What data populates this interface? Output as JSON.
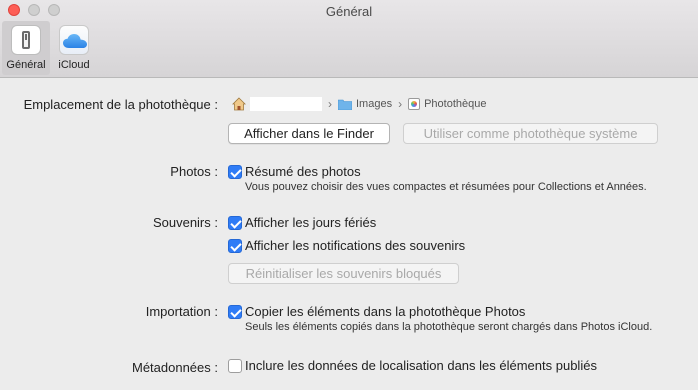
{
  "window": {
    "title": "Général"
  },
  "toolbar": {
    "items": [
      {
        "label": "Général",
        "icon": "general-switch-icon",
        "selected": true
      },
      {
        "label": "iCloud",
        "icon": "icloud-icon",
        "selected": false
      }
    ]
  },
  "library": {
    "label": "Emplacement de la photothèque :",
    "path": [
      {
        "icon": "home-icon",
        "text": ""
      },
      {
        "icon": "folder-icon",
        "text": "Images"
      },
      {
        "icon": "photo-library-icon",
        "text": "Photothèque"
      }
    ],
    "show_in_finder": "Afficher dans le Finder",
    "use_as_system_library": "Utiliser comme photothèque système"
  },
  "photos": {
    "label": "Photos :",
    "summarize": {
      "label": "Résumé des photos",
      "checked": true
    },
    "help": "Vous pouvez choisir des vues compactes et résumées pour Collections et Années."
  },
  "memories": {
    "label": "Souvenirs :",
    "holidays": {
      "label": "Afficher les jours fériés",
      "checked": true
    },
    "notifications": {
      "label": "Afficher les notifications des souvenirs",
      "checked": true
    },
    "reset_button": "Réinitialiser les souvenirs bloqués"
  },
  "importing": {
    "label": "Importation :",
    "copy_items": {
      "label": "Copier les éléments dans la photothèque Photos",
      "checked": true
    },
    "help": "Seuls les éléments copiés dans la photothèque seront chargés dans Photos iCloud."
  },
  "metadata": {
    "label": "Métadonnées :",
    "include_location": {
      "label": "Inclure les données de localisation dans les éléments publiés",
      "checked": false
    }
  },
  "colors": {
    "accent": "#2f7cf6",
    "close": "#fe5f57"
  }
}
